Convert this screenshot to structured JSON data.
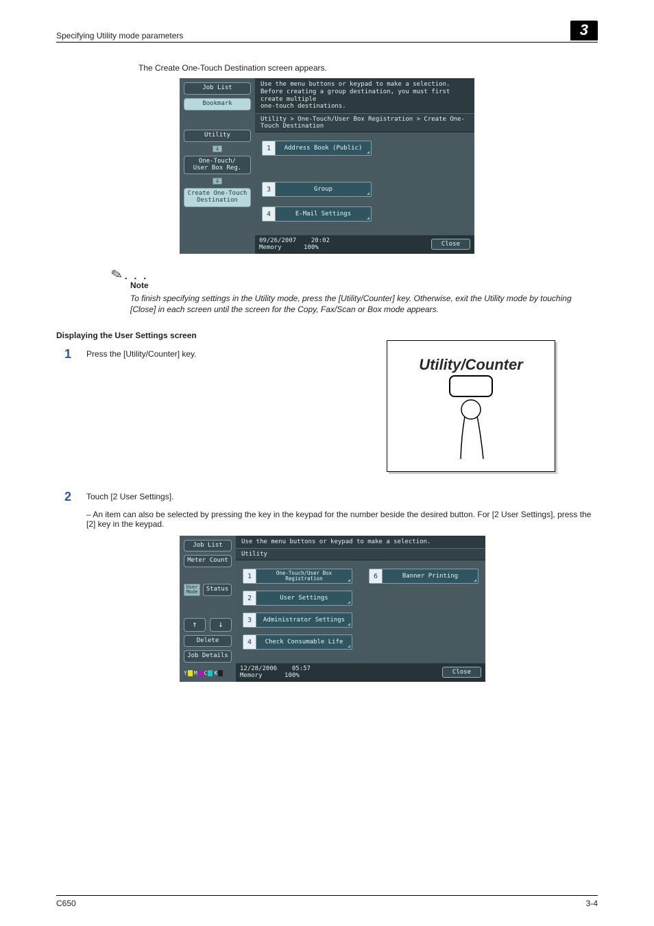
{
  "header": {
    "title": "Specifying Utility mode parameters",
    "chapter": "3"
  },
  "intro": "The Create One-Touch Destination screen appears.",
  "screen1": {
    "left": {
      "job_list": "Job List",
      "bookmark": "Bookmark",
      "utility": "Utility",
      "onetouch": "One-Touch/\nUser Box Reg.",
      "create": "Create One-Touch\nDestination"
    },
    "top": "Use the menu buttons or keypad to make a selection.\nBefore creating a group destination, you must first create multiple\none-touch destinations.",
    "crumb": "Utility > One-Touch/User Box Registration > Create One-Touch Destination",
    "items": [
      {
        "n": "1",
        "label": "Address Book (Public)"
      },
      {
        "n": "3",
        "label": "Group"
      },
      {
        "n": "4",
        "label": "E-Mail Settings"
      }
    ],
    "footer": {
      "date": "09/26/2007",
      "time": "20:02",
      "mem_label": "Memory",
      "mem_val": "100%",
      "close": "Close"
    }
  },
  "note": {
    "label": "Note",
    "body": "To finish specifying settings in the Utility mode, press the [Utility/Counter] key. Otherwise, exit the Utility mode by touching [Close] in each screen until the screen for the Copy, Fax/Scan or Box mode appears."
  },
  "section_h": "Displaying the User Settings screen",
  "step1": {
    "n": "1",
    "text": "Press the [Utility/Counter] key."
  },
  "keyfig": {
    "label": "Utility/Counter"
  },
  "step2": {
    "n": "2",
    "text": "Touch [2 User Settings].",
    "sub": "An item can also be selected by pressing the key in the keypad for the number beside the desired button. For [2 User Settings], press the [2] key in the keypad."
  },
  "screen2": {
    "left": {
      "job_list": "Job List",
      "meter": "Meter Count",
      "usermode": "User\nMode",
      "status": "Status",
      "delete": "Delete",
      "details": "Job Details",
      "toner": {
        "y": "Y",
        "m": "M",
        "c": "C",
        "k": "K"
      }
    },
    "top": "Use the menu buttons or keypad to make a selection.",
    "crumb": "Utility",
    "items_left": [
      {
        "n": "1",
        "label": "One-Touch/User Box\nRegistration"
      },
      {
        "n": "2",
        "label": "User Settings"
      },
      {
        "n": "3",
        "label": "Administrator Settings"
      },
      {
        "n": "4",
        "label": "Check Consumable Life"
      }
    ],
    "items_right": [
      {
        "n": "6",
        "label": "Banner Printing"
      }
    ],
    "footer": {
      "date": "12/28/2006",
      "time": "05:57",
      "mem_label": "Memory",
      "mem_val": "100%",
      "close": "Close"
    }
  },
  "footer": {
    "left": "C650",
    "right": "3-4"
  }
}
